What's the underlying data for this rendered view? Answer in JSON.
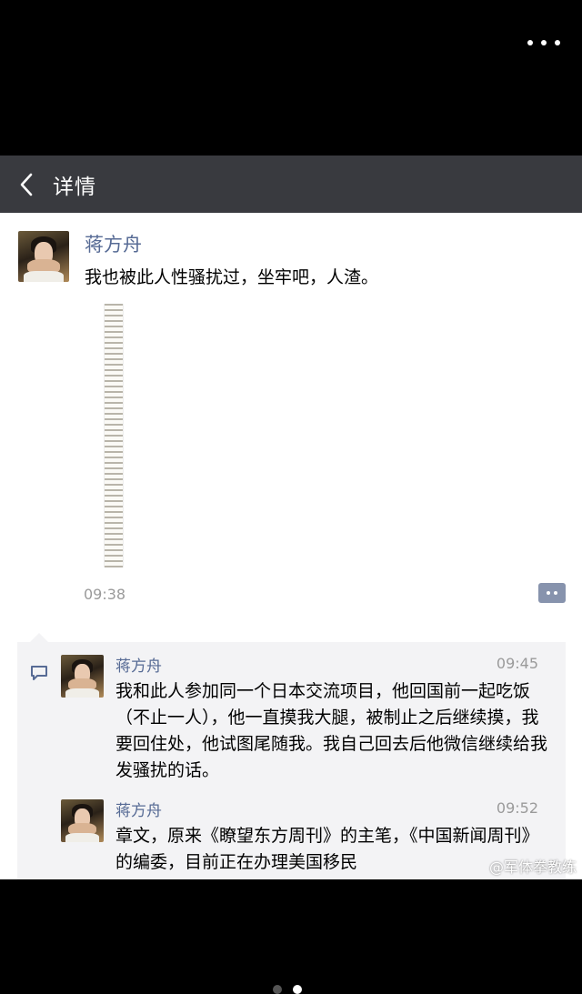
{
  "nav": {
    "title": "详情"
  },
  "post": {
    "author": "蒋方舟",
    "text": "我也被此人性骚扰过，坐牢吧，人渣。",
    "time": "09:38"
  },
  "comments": [
    {
      "author": "蒋方舟",
      "time": "09:45",
      "text": "我和此人参加同一个日本交流项目，他回国前一起吃饭（不止一人），他一直摸我大腿，被制止之后继续摸，我要回住处，他试图尾随我。我自己回去后他微信继续给我发骚扰的话。"
    },
    {
      "author": "蒋方舟",
      "time": "09:52",
      "text": "章文，原来《瞭望东方周刊》的主笔，《中国新闻周刊》的编委，目前正在办理美国移民"
    }
  ],
  "watermark": "@军体拳教练",
  "pager": {
    "count": 2,
    "active": 2
  },
  "colors": {
    "navbar": "#393a3f",
    "name_link": "#576b95",
    "comment_bg": "#f3f3f5"
  }
}
